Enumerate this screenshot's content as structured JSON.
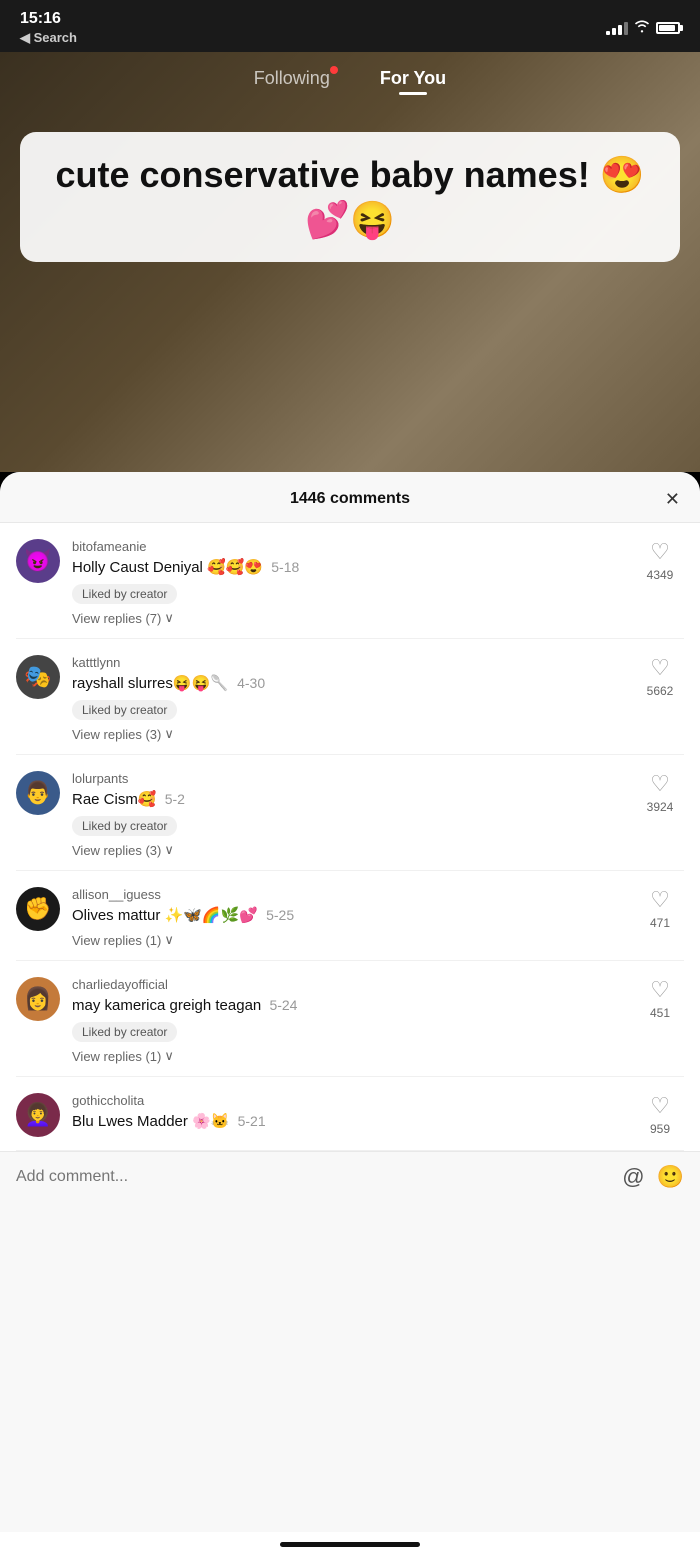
{
  "statusBar": {
    "time": "15:16",
    "searchLabel": "◀ Search"
  },
  "nav": {
    "following": "Following",
    "forYou": "For You",
    "activeTab": "forYou",
    "hasNotification": true
  },
  "videoCaption": {
    "text": "cute conservative baby names! 😍💕😝"
  },
  "comments": {
    "header": "1446 comments",
    "closeLabel": "✕",
    "items": [
      {
        "id": 1,
        "username": "bitofameanie",
        "text": "Holly Caust Deniyal 🥰🥰😍",
        "date": "5-18",
        "likedByCreator": true,
        "likedBadge": "Liked by creator",
        "viewReplies": "View replies (7)",
        "likes": "4349",
        "avatarEmoji": "🎭",
        "avatarColor": "av-purple"
      },
      {
        "id": 2,
        "username": "katttlynn",
        "text": "rayshall slurres😝😝🥄",
        "date": "4-30",
        "likedByCreator": true,
        "likedBadge": "Liked by creator",
        "viewReplies": "View replies (3)",
        "likes": "5662",
        "avatarEmoji": "🎭",
        "avatarColor": "av-gray"
      },
      {
        "id": 3,
        "username": "lolurpants",
        "text": "Rae Cism🥰",
        "date": "5-2",
        "likedByCreator": true,
        "likedBadge": "Liked by creator",
        "viewReplies": "View replies (3)",
        "likes": "3924",
        "avatarEmoji": "👤",
        "avatarColor": "av-dark"
      },
      {
        "id": 4,
        "username": "allison__iguess",
        "text": "Olives mattur ✨🦋🌈🌿💕",
        "date": "5-25",
        "likedByCreator": false,
        "likedBadge": "",
        "viewReplies": "View replies (1)",
        "likes": "471",
        "avatarEmoji": "✊",
        "avatarColor": "av-black"
      },
      {
        "id": 5,
        "username": "charliedayofficial",
        "text": "may kamerica greigh teagan",
        "date": "5-24",
        "likedByCreator": true,
        "likedBadge": "Liked by creator",
        "viewReplies": "View replies (1)",
        "likes": "451",
        "avatarEmoji": "👤",
        "avatarColor": "av-brown"
      },
      {
        "id": 6,
        "username": "gothiccholita",
        "text": "Blu Lwes Madder 🌸🐱",
        "date": "5-21",
        "likedByCreator": false,
        "likedBadge": "",
        "viewReplies": "",
        "likes": "959",
        "avatarEmoji": "👤",
        "avatarColor": "av-wine"
      }
    ],
    "addCommentPlaceholder": "Add comment...",
    "atIcon": "@",
    "emojiIcon": "🙂"
  }
}
